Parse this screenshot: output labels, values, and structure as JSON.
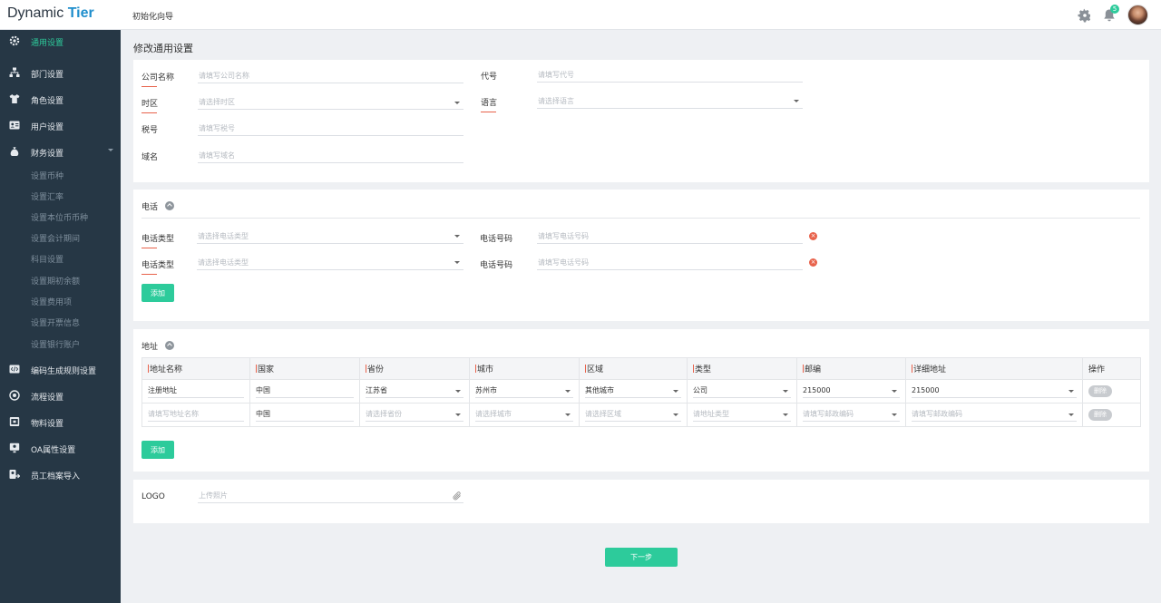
{
  "app": {
    "logo_main": "Dynamic ",
    "logo_accent": "Tier",
    "breadcrumb": "初始化向导"
  },
  "header": {
    "notification_count": "5"
  },
  "sidebar": {
    "items": [
      {
        "label": "通用设置",
        "icon": "gear-icon"
      },
      {
        "label": "部门设置",
        "icon": "org-icon"
      },
      {
        "label": "角色设置",
        "icon": "shirt-icon"
      },
      {
        "label": "用户设置",
        "icon": "id-card-icon"
      },
      {
        "label": "财务设置",
        "icon": "money-bag-icon"
      },
      {
        "label": "编码生成规则设置",
        "icon": "code-icon"
      },
      {
        "label": "流程设置",
        "icon": "flow-icon"
      },
      {
        "label": "物料设置",
        "icon": "box-icon"
      },
      {
        "label": "OA属性设置",
        "icon": "oa-icon"
      },
      {
        "label": "员工档案导入",
        "icon": "import-icon"
      }
    ],
    "finance_sub": [
      "设置币种",
      "设置汇率",
      "设置本位币币种",
      "设置会计期间",
      "科目设置",
      "设置期初余额",
      "设置费用项",
      "设置开票信息",
      "设置银行账户"
    ]
  },
  "main": {
    "title": "修改通用设置",
    "general": {
      "company_label": "公司名称",
      "company_ph": "请填写公司名称",
      "code_label": "代号",
      "code_ph": "请填写代号",
      "tz_label": "时区",
      "tz_ph": "请选择时区",
      "lang_label": "语言",
      "lang_ph": "请选择语言",
      "tax_label": "税号",
      "tax_ph": "请填写税号",
      "domain_label": "域名",
      "domain_ph": "请填写域名"
    },
    "phone": {
      "title": "电话",
      "rows": [
        {
          "type_label": "电话类型",
          "type_ph": "请选择电话类型",
          "num_label": "电话号码",
          "num_ph": "请填写电话号码"
        },
        {
          "type_label": "电话类型",
          "type_ph": "请选择电话类型",
          "num_label": "电话号码",
          "num_ph": "请填写电话号码"
        }
      ],
      "add_label": "添加"
    },
    "address": {
      "title": "地址",
      "headers": [
        "地址名称",
        "国家",
        "省份",
        "城市",
        "区域",
        "类型",
        "邮编",
        "详细地址",
        "操作"
      ],
      "rows": [
        {
          "name": "注册地址",
          "country": "中国",
          "province": "江苏省",
          "city": "苏州市",
          "district": "其他城市",
          "type": "公司",
          "zip": "215000",
          "detail": "215000",
          "action": "删除"
        },
        {
          "name": "请填写地址名称",
          "country": "中国",
          "province": "请选择省份",
          "city": "请选择城市",
          "district": "请选择区域",
          "type": "请地址类型",
          "zip": "请填写邮政编码",
          "detail": "请填写邮政编码",
          "action": "删除"
        }
      ],
      "add_label": "添加"
    },
    "logo": {
      "label": "LOGO",
      "ph": "上传照片"
    },
    "next_label": "下一步"
  },
  "colors": {
    "accent": "#2dcb9b",
    "sidebar_bg": "#263745",
    "danger": "#e8624b",
    "logo_accent": "#1f8ecc"
  }
}
